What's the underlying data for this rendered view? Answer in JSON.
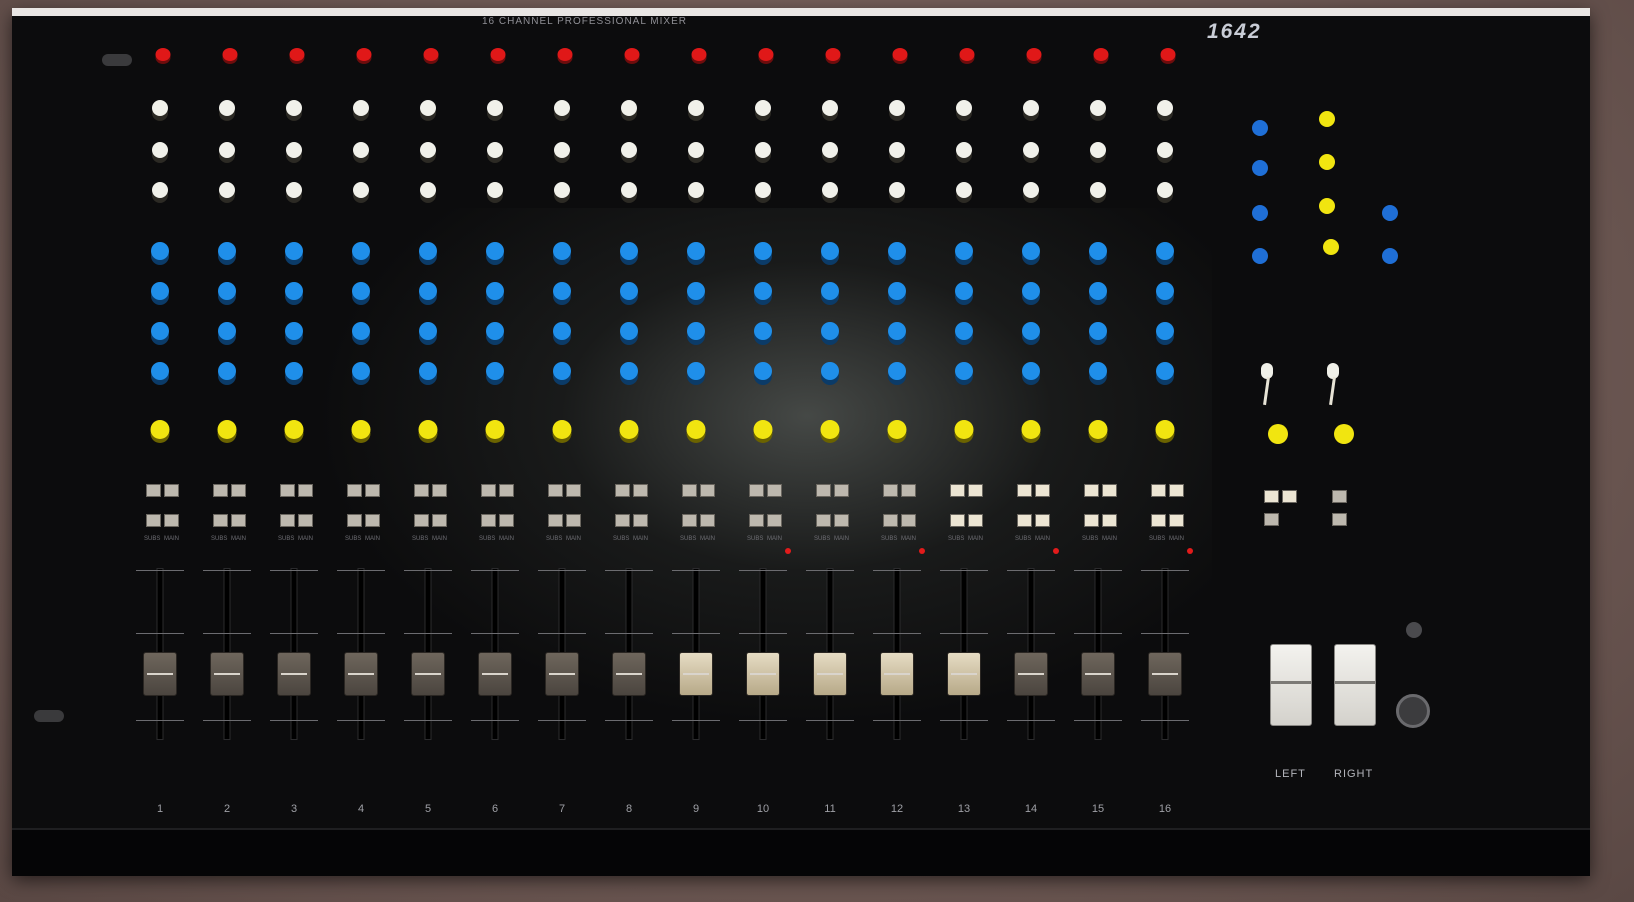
{
  "device": {
    "top_label": "16 CHANNEL PROFESSIONAL MIXER",
    "model": "1642"
  },
  "channels": [
    "1",
    "2",
    "3",
    "4",
    "5",
    "6",
    "7",
    "8",
    "9",
    "10",
    "11",
    "12",
    "13",
    "14",
    "15",
    "16"
  ],
  "master_labels": {
    "left": "LEFT",
    "right": "RIGHT"
  },
  "knob_colors": {
    "gain": "#e01818",
    "eq": "#f1f1ea",
    "aux": "#1f8fea",
    "pan": "#f1e510"
  },
  "button_labels": {
    "subs": "SUBS",
    "main": "MAIN"
  }
}
